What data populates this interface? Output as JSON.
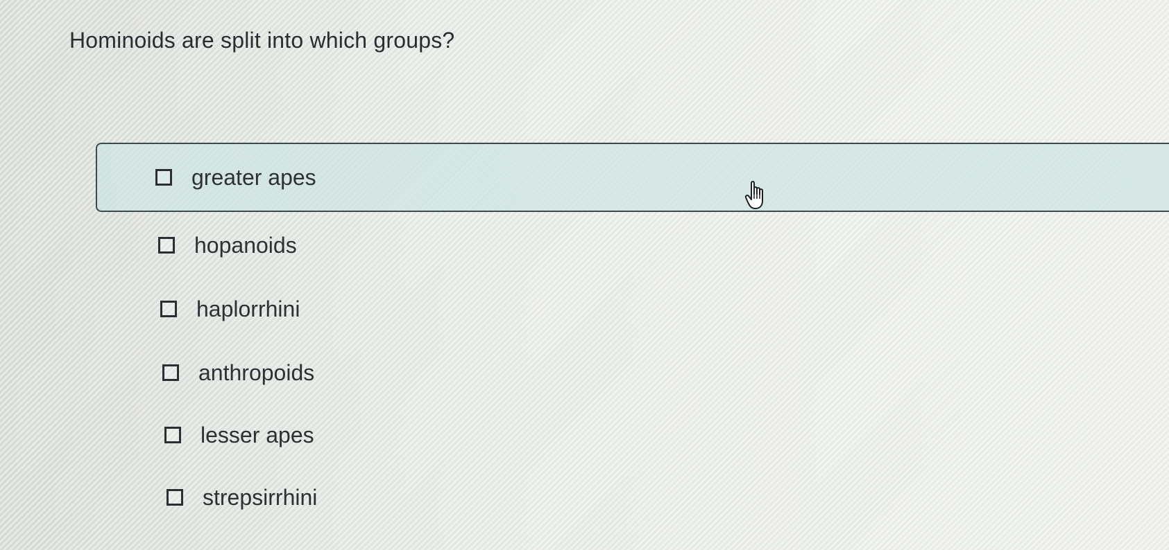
{
  "question": {
    "text": "Hominoids are split into which groups?"
  },
  "options": [
    {
      "label": "greater apes",
      "checked": false,
      "highlighted": true
    },
    {
      "label": "hopanoids",
      "checked": false,
      "highlighted": false
    },
    {
      "label": "haplorrhini",
      "checked": false,
      "highlighted": false
    },
    {
      "label": "anthropoids",
      "checked": false,
      "highlighted": false
    },
    {
      "label": "lesser apes",
      "checked": false,
      "highlighted": false
    },
    {
      "label": "strepsirrhini",
      "checked": false,
      "highlighted": false
    }
  ],
  "cursor": {
    "icon": "hand-pointer-icon"
  },
  "colors": {
    "highlight_background": "#cde4e2",
    "highlight_border": "#3a4a4f",
    "text": "#2b2f33"
  }
}
